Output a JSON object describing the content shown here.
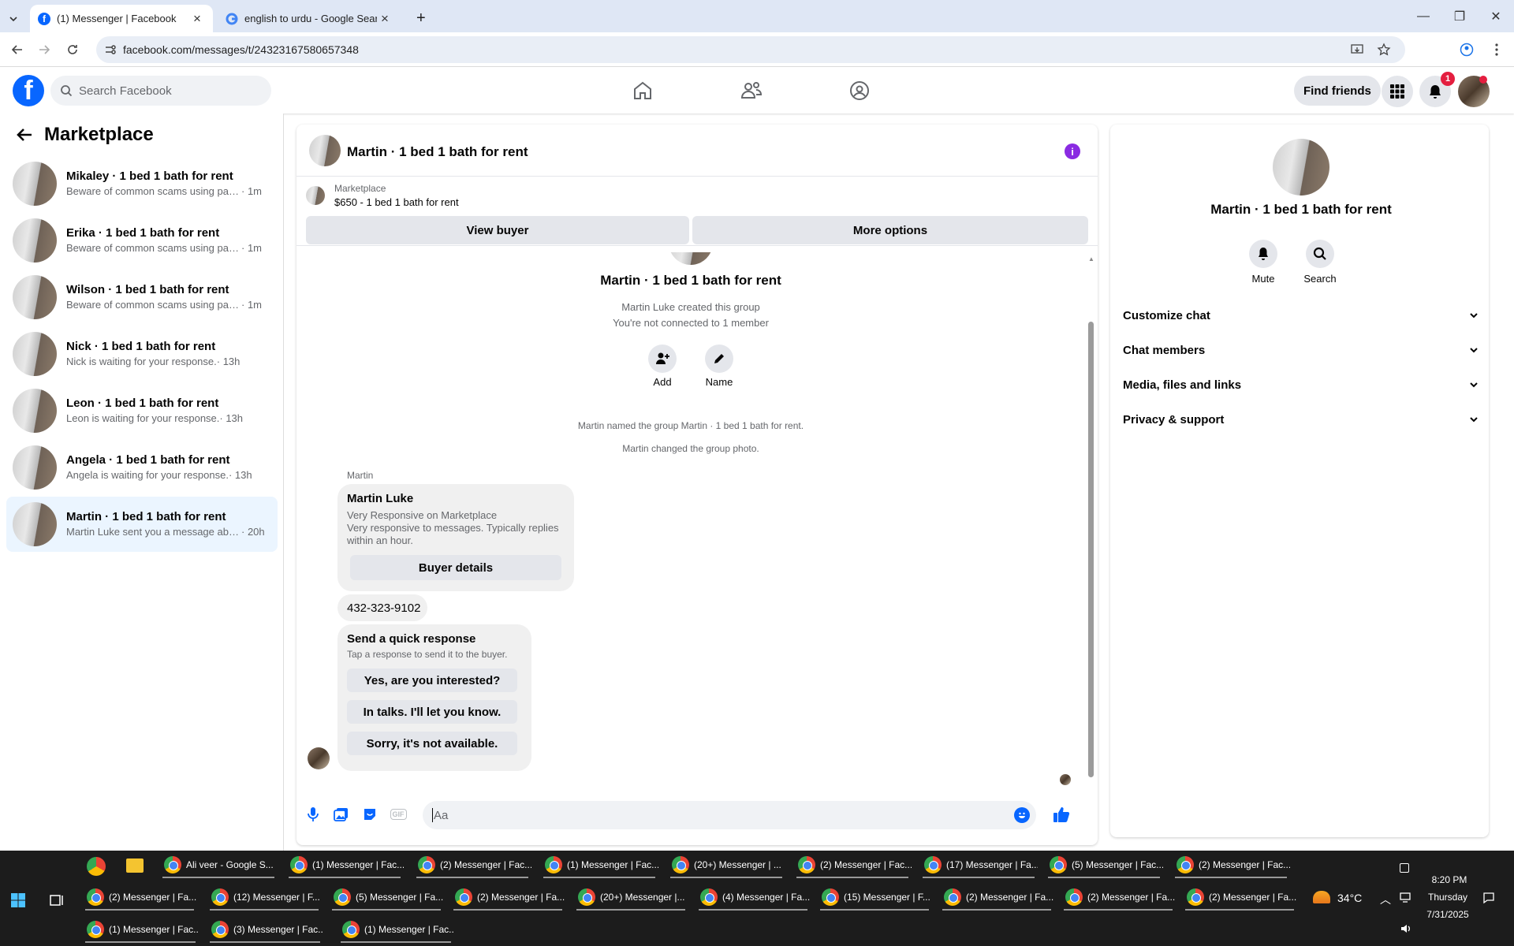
{
  "browser": {
    "tabs": [
      {
        "title": "(1) Messenger | Facebook"
      },
      {
        "title": "english to urdu - Google Search"
      }
    ],
    "url": "facebook.com/messages/t/24323167580657348"
  },
  "fb": {
    "search_placeholder": "Search Facebook",
    "find_friends": "Find friends",
    "notif_count": "1"
  },
  "sidebar": {
    "title": "Marketplace",
    "conversations": [
      {
        "name": "Mikaley · 1 bed 1 bath for rent",
        "preview": "Beware of common scams using pay...",
        "time": "· 1m",
        "selected": false
      },
      {
        "name": "Erika · 1 bed 1 bath for rent",
        "preview": "Beware of common scams using pay...",
        "time": "· 1m",
        "selected": false
      },
      {
        "name": "Wilson · 1 bed 1 bath for rent",
        "preview": "Beware of common scams using pay...",
        "time": "· 1m",
        "selected": false
      },
      {
        "name": "Nick · 1 bed 1 bath for rent",
        "preview": "Nick is waiting for your response.",
        "time": "· 13h",
        "selected": false
      },
      {
        "name": "Leon · 1 bed 1 bath for rent",
        "preview": "Leon is waiting for your response.",
        "time": "· 13h",
        "selected": false
      },
      {
        "name": "Angela · 1 bed 1 bath for rent",
        "preview": "Angela is waiting for your response.",
        "time": "· 13h",
        "selected": false
      },
      {
        "name": "Martin · 1 bed 1 bath for rent",
        "preview": "Martin Luke sent you a message abo...",
        "time": "· 20h",
        "selected": true
      }
    ]
  },
  "chat": {
    "title": "Martin · 1 bed 1 bath for rent",
    "listing_source": "Marketplace",
    "listing": "$650 - 1 bed 1 bath for rent",
    "view_buyer": "View buyer",
    "more_options": "More options",
    "group_name": "Martin · 1 bed 1 bath for rent",
    "created": "Martin Luke created this group",
    "not_connected": "You're not connected to 1 member",
    "add_label": "Add",
    "name_label": "Name",
    "event1": "Martin named the group Martin · 1 bed 1 bath for rent.",
    "event2": "Martin changed the group photo.",
    "sender": "Martin",
    "card": {
      "name": "Martin Luke",
      "line1": "Very Responsive on Marketplace",
      "line2": "Very responsive to messages. Typically replies within an hour.",
      "button": "Buyer details"
    },
    "phone": "432-323-9102",
    "quick": {
      "title": "Send a quick response",
      "subtitle": "Tap a response to send it to the buyer.",
      "options": [
        "Yes, are you interested?",
        "In talks. I'll let you know.",
        "Sorry, it's not available."
      ]
    },
    "composer_placeholder": "Aa"
  },
  "details": {
    "name": "Martin · 1 bed 1 bath for rent",
    "mute": "Mute",
    "search": "Search",
    "sections": [
      "Customize chat",
      "Chat members",
      "Media, files and links",
      "Privacy & support"
    ]
  },
  "taskbar": {
    "row1": [
      "Ali veer - Google S...",
      "(1) Messenger | Fac...",
      "(2) Messenger | Fac...",
      "(1) Messenger | Fac...",
      "(20+) Messenger | ...",
      "(2) Messenger | Fac...",
      "(17) Messenger | Fa...",
      "(5) Messenger | Fac...",
      "(2) Messenger | Fac..."
    ],
    "row2": [
      "(2) Messenger | Fa...",
      "(12) Messenger | F...",
      "(5) Messenger | Fa...",
      "(2) Messenger | Fa...",
      "(20+) Messenger |...",
      "(4) Messenger | Fa...",
      "(15) Messenger | F...",
      "(2) Messenger | Fa...",
      "(2) Messenger | Fa...",
      "(2) Messenger | Fa..."
    ],
    "row3": [
      "(1) Messenger | Fac...",
      "(3) Messenger | Fac...",
      "(1) Messenger | Fac..."
    ],
    "temp": "34°C",
    "time": "8:20 PM",
    "day": "Thursday",
    "date": "7/31/2025"
  }
}
